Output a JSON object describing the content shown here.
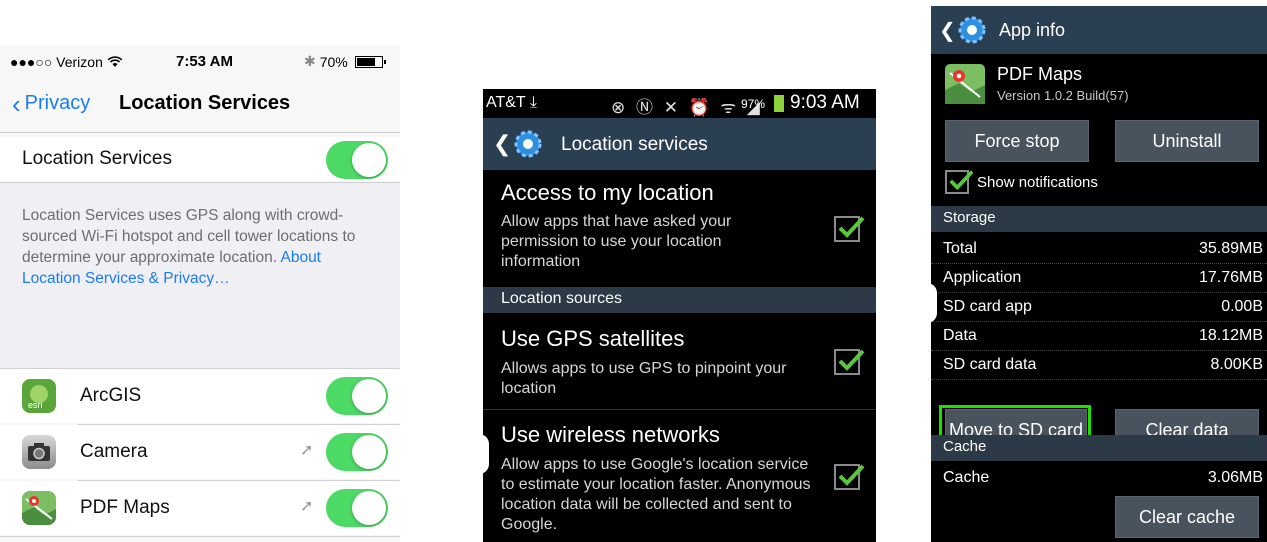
{
  "ios": {
    "status": {
      "carrier": "●●●○○ Verizon",
      "time": "7:53 AM",
      "battery": "70%"
    },
    "nav": {
      "back_label": "Privacy",
      "title": "Location Services"
    },
    "main_toggle": {
      "label": "Location Services",
      "on": true
    },
    "description": "Location Services uses GPS along with crowd-sourced Wi-Fi hotspot and cell tower locations to determine your approximate location. ",
    "description_link": "About Location Services & Privacy…",
    "apps": [
      {
        "name": "ArcGIS",
        "icon": "esri-icon",
        "on": true,
        "location_arrow": false
      },
      {
        "name": "Camera",
        "icon": "camera-icon",
        "on": true,
        "location_arrow": true
      },
      {
        "name": "PDF Maps",
        "icon": "pdf-maps-icon",
        "on": true,
        "location_arrow": true
      }
    ],
    "accent": "#1a7cf5",
    "toggle_color": "#4cd964"
  },
  "android_location": {
    "status": {
      "carrier": "AT&T",
      "battery_pct": "97%",
      "time": "9:03 AM"
    },
    "title": "Location services",
    "items": [
      {
        "title": "Access to my location",
        "subtitle": "Allow apps that have asked your permission to use your location information",
        "checked": true
      }
    ],
    "section": "Location sources",
    "sources": [
      {
        "title": "Use GPS satellites",
        "subtitle": "Allows apps to use GPS to pinpoint your location",
        "checked": true
      },
      {
        "title": "Use wireless networks",
        "subtitle": "Allow apps to use Google's location service to estimate your location faster. Anonymous location data will be collected and sent to Google.",
        "checked": true
      }
    ]
  },
  "android_appinfo": {
    "title": "App info",
    "app_name": "PDF Maps",
    "app_version": "Version 1.0.2 Build(57)",
    "force_stop_label": "Force stop",
    "uninstall_label": "Uninstall",
    "show_notifications_label": "Show notifications",
    "show_notifications_checked": true,
    "storage_section": "Storage",
    "storage_rows": [
      {
        "key": "Total",
        "value": "35.89MB"
      },
      {
        "key": "Application",
        "value": "17.76MB"
      },
      {
        "key": "SD card app",
        "value": "0.00B"
      },
      {
        "key": "Data",
        "value": "18.12MB"
      },
      {
        "key": "SD card data",
        "value": "8.00KB"
      }
    ],
    "move_to_sd_label": "Move to SD card",
    "clear_data_label": "Clear data",
    "cache_section": "Cache",
    "cache_row": {
      "key": "Cache",
      "value": "3.06MB"
    },
    "clear_cache_label": "Clear cache",
    "highlight_color": "#1ee000"
  }
}
